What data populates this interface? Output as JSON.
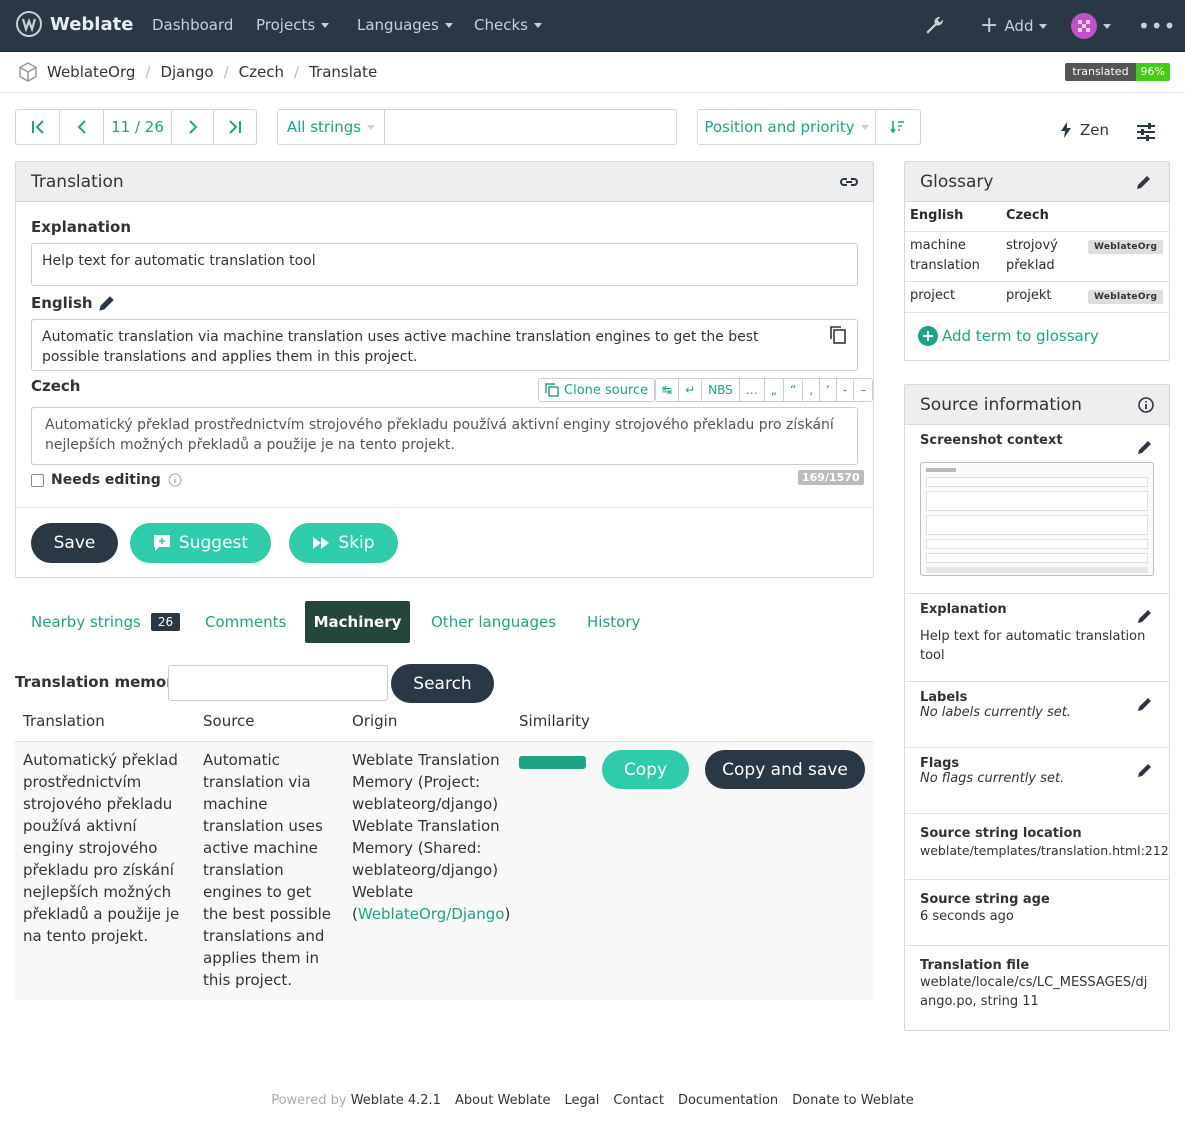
{
  "navbar": {
    "brand": "Weblate",
    "items": [
      "Dashboard",
      "Projects",
      "Languages",
      "Checks"
    ],
    "add_label": "Add"
  },
  "breadcrumb": [
    "WeblateOrg",
    "Django",
    "Czech",
    "Translate"
  ],
  "progress": {
    "label": "translated",
    "value": "96%"
  },
  "toolbar": {
    "position": "11 / 26",
    "filter": "All strings",
    "search_placeholder": "",
    "sort": "Position and priority",
    "zen": "Zen"
  },
  "translation_panel": {
    "title": "Translation",
    "explanation_label": "Explanation",
    "explanation_value": "Help text for automatic translation tool",
    "source_label": "English",
    "source_text": "Automatic translation via machine translation uses active machine translation engines to get the best possible translations and applies them in this project.",
    "target_label": "Czech",
    "clone_source": "Clone source",
    "special_chars": [
      "↹",
      "↵",
      "NBS",
      "…",
      "„",
      "“",
      "‚",
      "‘",
      "-",
      "–"
    ],
    "target_text": "Automatický překlad prostřednictvím strojového překladu používá aktivní enginy strojového překladu pro získání nejlepších možných překladů a použije je na tento projekt.",
    "needs_editing": "Needs editing",
    "char_count": "169/1570",
    "save": "Save",
    "suggest": "Suggest",
    "skip": "Skip"
  },
  "tabs": {
    "nearby": "Nearby strings",
    "nearby_count": "26",
    "comments": "Comments",
    "machinery": "Machinery",
    "other_languages": "Other languages",
    "history": "History"
  },
  "memory": {
    "label": "Translation memory",
    "search": "Search",
    "columns": [
      "Translation",
      "Source",
      "Origin",
      "Similarity"
    ],
    "row": {
      "translation": "Automatický překlad prostřednictvím strojového překladu používá aktivní enginy strojového překladu pro získání nejlepších možných překladů a použije je na tento projekt.",
      "source": "Automatic translation via machine translation uses active machine translation engines to get the best possible translations and applies them in this project.",
      "origin_1": "Weblate Translation Memory (Project: weblateorg/django)",
      "origin_2": "Weblate Translation Memory (Shared: weblateorg/django)",
      "origin_3_prefix": "Weblate (",
      "origin_3_link": "WeblateOrg/Django",
      "origin_3_suffix": ")",
      "similarity": 1.0,
      "copy": "Copy",
      "copy_save": "Copy and save"
    }
  },
  "glossary": {
    "title": "Glossary",
    "col_en": "English",
    "col_cs": "Czech",
    "rows": [
      {
        "en": "machine translation",
        "cs": "strojový překlad",
        "tag": "WeblateOrg"
      },
      {
        "en": "project",
        "cs": "projekt",
        "tag": "WeblateOrg"
      }
    ],
    "add_term": "Add term to glossary"
  },
  "source_info": {
    "title": "Source information",
    "screenshot_label": "Screenshot context",
    "explanation_label": "Explanation",
    "explanation_value": "Help text for automatic translation tool",
    "labels_label": "Labels",
    "labels_value": "No labels currently set.",
    "flags_label": "Flags",
    "flags_value": "No flags currently set.",
    "location_label": "Source string location",
    "location_value": "weblate/templates/translation.html:212",
    "age_label": "Source string age",
    "age_value": "6 seconds ago",
    "file_label": "Translation file",
    "file_value": "weblate/locale/cs/LC_MESSAGES/django.po, string 11"
  },
  "footer": {
    "powered_by": "Powered by",
    "version": "Weblate 4.2.1",
    "links": [
      "About Weblate",
      "Legal",
      "Contact",
      "Documentation",
      "Donate to Weblate"
    ]
  },
  "colors": {
    "navbar": "#2a3744",
    "accent": "#1fa385",
    "button_green": "#2eccaa",
    "progress": "#44cc11"
  }
}
